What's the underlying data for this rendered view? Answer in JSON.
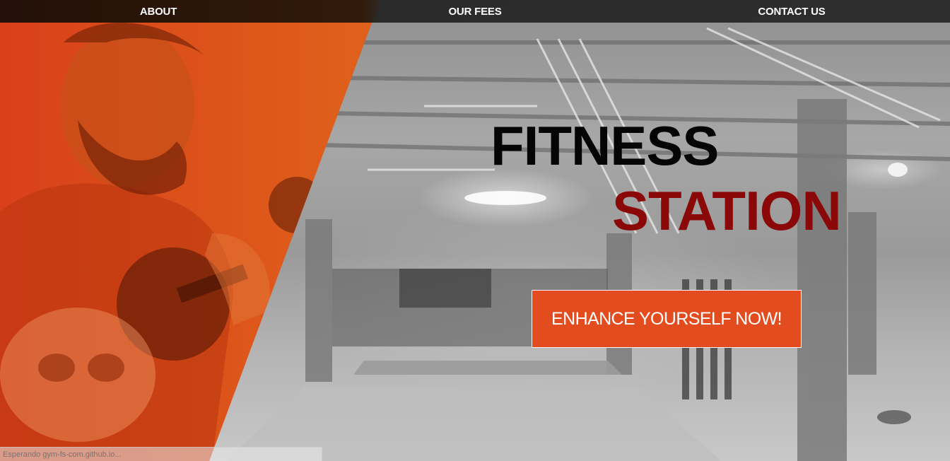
{
  "nav": {
    "items": [
      {
        "label": "ABOUT"
      },
      {
        "label": "OUR FEES"
      },
      {
        "label": "CONTACT US"
      }
    ]
  },
  "hero": {
    "title_line1": "FITNESS",
    "title_line2": "STATION",
    "cta_label": "ENHANCE YOURSELF NOW!"
  },
  "status_bar": {
    "text": "Esperando gym-fs-com.github.io..."
  },
  "colors": {
    "accent": "#e34c1e",
    "panel_orange": "#e0661b",
    "title_dark": "#050505",
    "title_red": "#8a0808"
  }
}
